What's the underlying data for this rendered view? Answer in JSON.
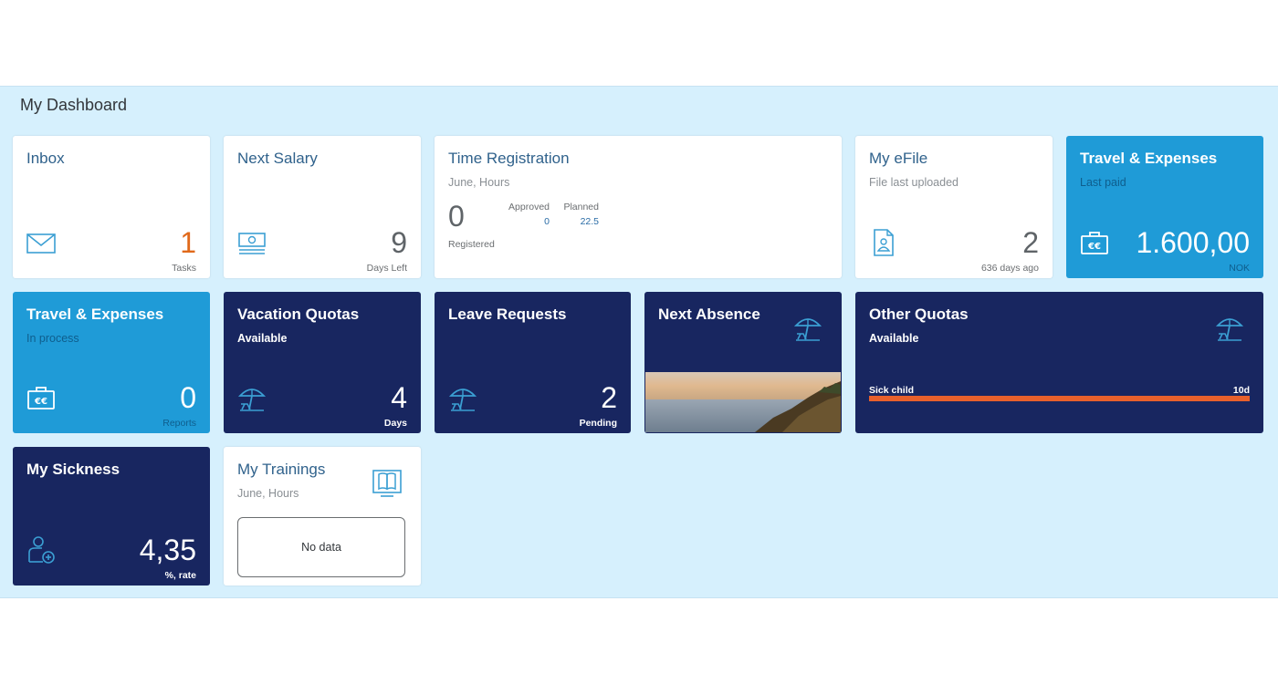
{
  "dashboard": {
    "title": "My Dashboard",
    "tiles": {
      "inbox": {
        "title": "Inbox",
        "value": "1",
        "unit": "Tasks",
        "icon": "envelope-icon"
      },
      "salary": {
        "title": "Next Salary",
        "value": "9",
        "unit": "Days Left",
        "icon": "money-icon"
      },
      "time": {
        "title": "Time Registration",
        "subtitle": "June, Hours",
        "registered_value": "0",
        "registered_label": "Registered",
        "approved_label": "Approved",
        "approved_value": "0",
        "planned_label": "Planned",
        "planned_value": "22.5"
      },
      "efile": {
        "title": "My eFile",
        "subtitle": "File last uploaded",
        "value": "2",
        "unit": "636 days ago",
        "icon": "document-icon"
      },
      "travel_paid": {
        "title": "Travel & Expenses",
        "subtitle": "Last paid",
        "value": "1.600,00",
        "unit": "NOK",
        "icon": "briefcase-euro-icon"
      },
      "travel_process": {
        "title": "Travel & Expenses",
        "subtitle": "In process",
        "value": "0",
        "unit": "Reports",
        "icon": "briefcase-euro-icon"
      },
      "vacation": {
        "title": "Vacation Quotas",
        "subtitle": "Available",
        "value": "4",
        "unit": "Days",
        "icon": "beach-umbrella-icon"
      },
      "leave": {
        "title": "Leave Requests",
        "value": "2",
        "unit": "Pending",
        "icon": "beach-umbrella-icon"
      },
      "absence": {
        "title": "Next Absence",
        "icon": "beach-umbrella-icon"
      },
      "other_quotas": {
        "title": "Other Quotas",
        "subtitle": "Available",
        "bar_label": "Sick child",
        "bar_value": "10d",
        "bar_fill": 1.0,
        "icon": "beach-umbrella-icon"
      },
      "sickness": {
        "title": "My Sickness",
        "value": "4,35",
        "unit": "%, rate",
        "icon": "person-medical-icon"
      },
      "trainings": {
        "title": "My Trainings",
        "subtitle": "June, Hours",
        "empty_text": "No data",
        "icon": "book-screen-icon"
      }
    },
    "colors": {
      "background": "#d6f0fd",
      "blue_tile": "#1f9bd7",
      "navy_tile": "#182660",
      "accent_orange": "#e0691a",
      "bar_fill": "#e8602c"
    }
  }
}
